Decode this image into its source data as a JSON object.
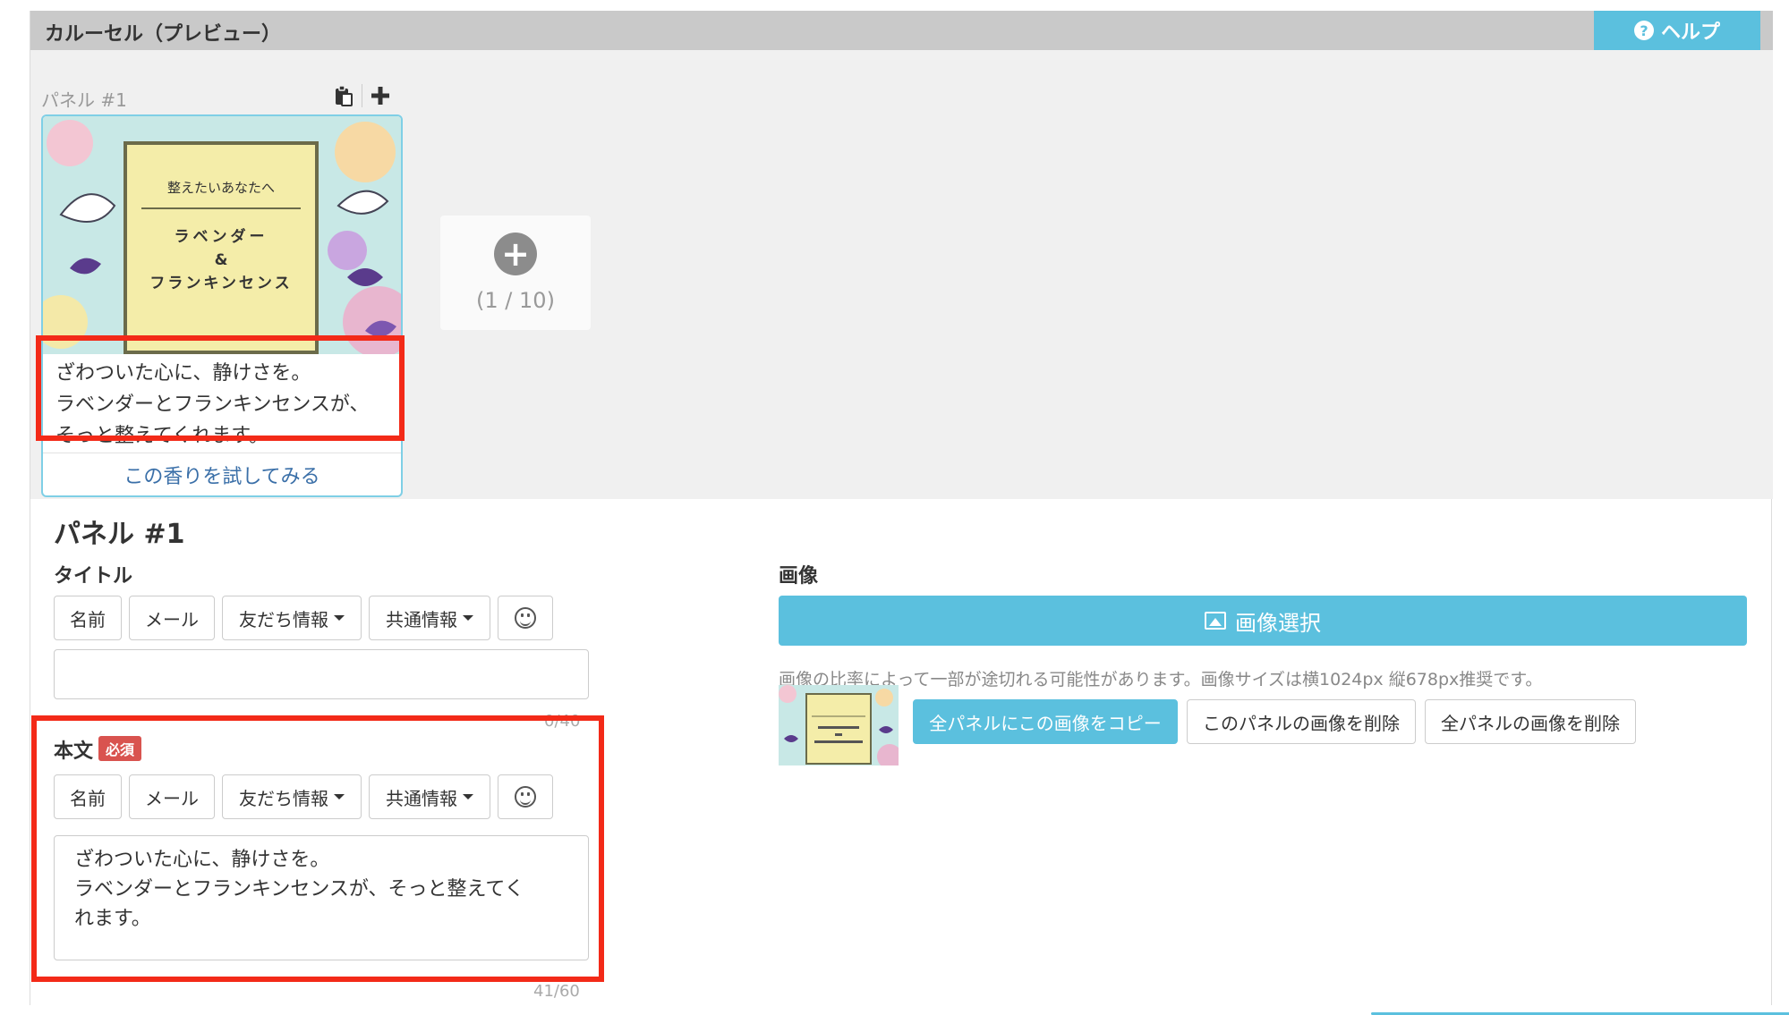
{
  "header": {
    "title": "カルーセル（プレビュー）",
    "help_label": "ヘルプ",
    "help_icon": "question-circle-icon"
  },
  "preview": {
    "panel_label": "パネル #1",
    "card": {
      "image_heading": "整えたいあなたへ",
      "image_title_lines": [
        "ラベンダー",
        "&",
        "フランキンセンス"
      ],
      "text_lines": [
        "ざわついた心に、静けさを。",
        "ラベンダーとフランキンセンスが、",
        "そっと整えてくれます。"
      ],
      "link_label": "この香りを試してみる"
    },
    "add_panel": {
      "count": "(1 / 10)"
    }
  },
  "editor": {
    "section_title": "パネル #1",
    "title_field": {
      "label": "タイトル",
      "buttons": [
        "名前",
        "メール",
        "友だち情報",
        "共通情報"
      ],
      "value": "",
      "counter": "0/40"
    },
    "body_field": {
      "label": "本文",
      "required_badge": "必須",
      "buttons": [
        "名前",
        "メール",
        "友だち情報",
        "共通情報"
      ],
      "value": "ざわついた心に、静けさを。\nラベンダーとフランキンセンスが、そっと整えてく\nれます。",
      "counter": "41/60"
    }
  },
  "image": {
    "label": "画像",
    "select_label": "画像選択",
    "hint": "画像の比率によって一部が途切れる可能性があります。画像サイズは横1024px 縦678px推奨です。",
    "actions": [
      "全パネルにこの画像をコピー",
      "このパネルの画像を削除",
      "全パネルの画像を削除"
    ]
  },
  "colors": {
    "accent": "#5bc0de",
    "highlight": "#f32a18",
    "required": "#d9534f",
    "link": "#3a6fa8"
  }
}
